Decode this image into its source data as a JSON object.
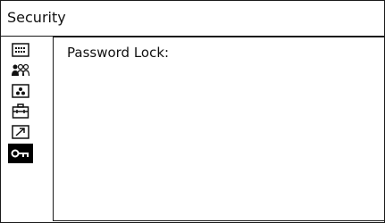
{
  "header": {
    "title": "Security"
  },
  "sidebar": {
    "items": [
      {
        "icon": "menu-list-icon"
      },
      {
        "icon": "users-icon"
      },
      {
        "icon": "color-dots-icon"
      },
      {
        "icon": "toolbox-icon"
      },
      {
        "icon": "arrow-diagonal-icon"
      },
      {
        "icon": "key-icon",
        "selected": true
      }
    ]
  },
  "main": {
    "password_lock_label": "Password Lock:"
  },
  "colors": {
    "border": "#1a1a1a",
    "selected_bg": "#000000",
    "background": "#ffffff"
  }
}
